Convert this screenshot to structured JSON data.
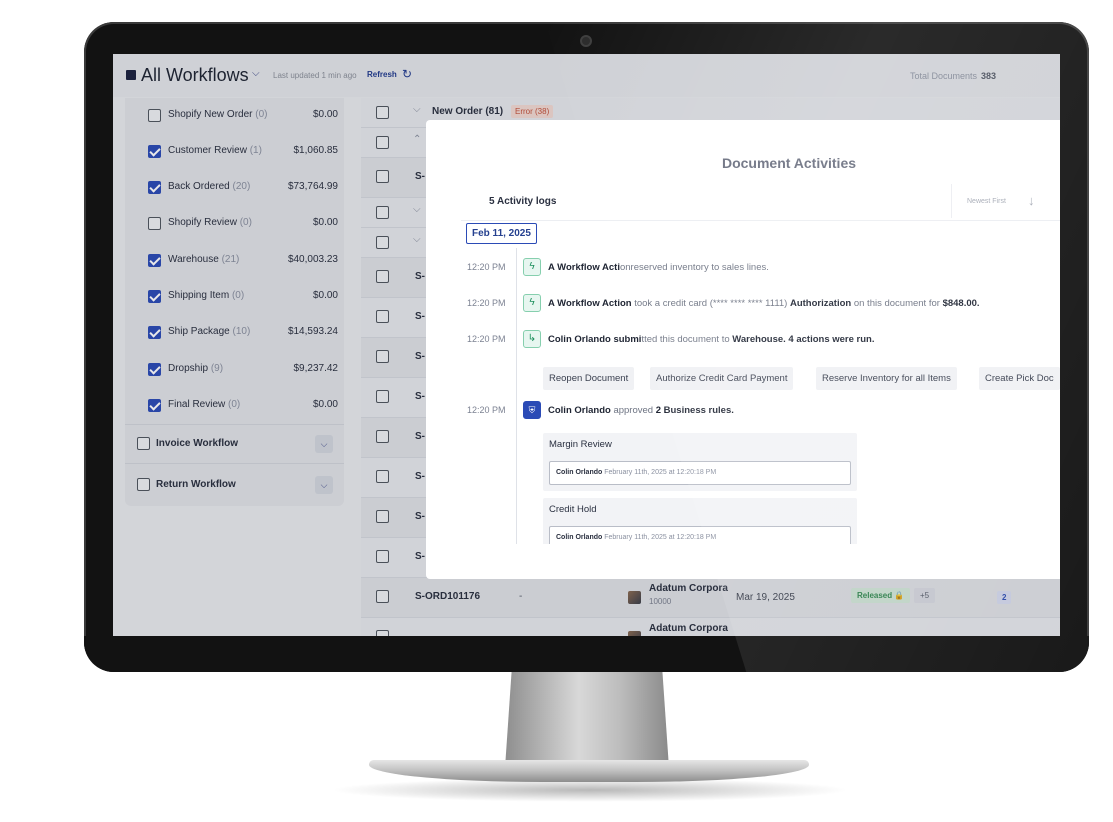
{
  "header": {
    "title": "All Workflows",
    "last_updated": "Last updated 1 min ago",
    "refresh_label": "Refresh",
    "total_label": "Total Documents",
    "total_value": "383"
  },
  "sidebar": {
    "items": [
      {
        "label": "Shopify New Order",
        "count": "(0)",
        "amount": "$0.00",
        "checked": false
      },
      {
        "label": "Customer Review",
        "count": "(1)",
        "amount": "$1,060.85",
        "checked": true
      },
      {
        "label": "Back Ordered",
        "count": "(20)",
        "amount": "$73,764.99",
        "checked": true
      },
      {
        "label": "Shopify Review",
        "count": "(0)",
        "amount": "$0.00",
        "checked": false
      },
      {
        "label": "Warehouse",
        "count": "(21)",
        "amount": "$40,003.23",
        "checked": true
      },
      {
        "label": "Shipping Item",
        "count": "(0)",
        "amount": "$0.00",
        "checked": true
      },
      {
        "label": "Ship Package",
        "count": "(10)",
        "amount": "$14,593.24",
        "checked": true
      },
      {
        "label": "Dropship",
        "count": "(9)",
        "amount": "$9,237.42",
        "checked": true
      },
      {
        "label": "Final Review",
        "count": "(0)",
        "amount": "$0.00",
        "checked": true
      }
    ],
    "groups": [
      {
        "label": "Invoice Workflow"
      },
      {
        "label": "Return Workflow"
      }
    ]
  },
  "table": {
    "group_title": "New Order (81)",
    "error_badge": "Error (38)",
    "row_prefix": "S-",
    "visible_row": {
      "id": "S-ORD101176",
      "dash": "-",
      "customer": "Adatum Corpora",
      "customer_sub": "10000",
      "date": "Mar 19, 2025",
      "status": "Released 🔒",
      "plus": "+5",
      "count": "2"
    },
    "partial_row": {
      "customer": "Adatum Corpora"
    }
  },
  "modal": {
    "title": "Document Activities",
    "logs_label": "5 Activity logs",
    "sort_label": "Newest First",
    "date_chip": "Feb 11, 2025",
    "activities": [
      {
        "time": "12:20 PM",
        "icon": "bolt-icon",
        "actor": "A Workflow Acti",
        "actor_rest": "on",
        "text": "reserved inventory to sales lines."
      },
      {
        "time": "12:20 PM",
        "icon": "bolt-icon",
        "actor": "A Workflow Action",
        "text": " took a credit card (**** **** **** 1111) ",
        "bold2": "Authorization",
        "text2": " on this document for ",
        "bold3": "$848.00."
      },
      {
        "time": "12:20 PM",
        "icon": "route-icon",
        "actor": "Colin Orlando",
        "text_a": " submi",
        "text_b": "tted this document to ",
        "bold2": "Warehouse. 4 actions were run."
      },
      {
        "time": "12:20 PM",
        "icon": "shield-icon",
        "actor": "Colin Orlando",
        "text": " approved ",
        "bold2": "2 Business rules."
      }
    ],
    "actions": [
      "Reopen Document",
      "Authorize Credit Card Payment",
      "Reserve Inventory for all Items",
      "Create Pick Doc"
    ],
    "rules": [
      {
        "title": "Margin Review",
        "user": "Colin Orlando",
        "stamp": "February 11th, 2025 at 12:20:18 PM"
      },
      {
        "title": "Credit Hold",
        "user": "Colin Orlando",
        "stamp": "February 11th, 2025 at 12:20:18 PM"
      }
    ]
  }
}
